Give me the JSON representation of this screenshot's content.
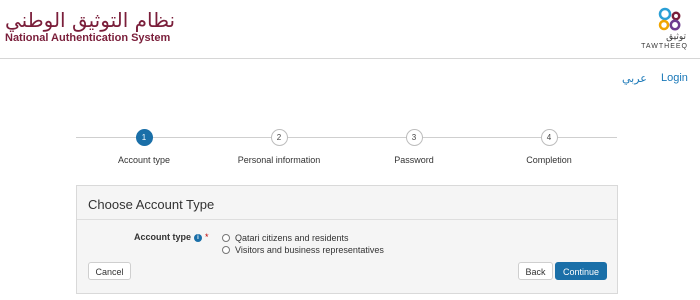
{
  "header": {
    "title_ar": "نظام التوثيق الوطني",
    "title_en": "National Authentication System",
    "logo_text_ar": "توثيق",
    "logo_text_en": "TAWTHEEQ"
  },
  "nav": {
    "language_label": "عربي",
    "login_label": "Login"
  },
  "stepper": {
    "steps": [
      {
        "number": "1",
        "label": "Account type",
        "active": true
      },
      {
        "number": "2",
        "label": "Personal information",
        "active": false
      },
      {
        "number": "3",
        "label": "Password",
        "active": false
      },
      {
        "number": "4",
        "label": "Completion",
        "active": false
      }
    ]
  },
  "form": {
    "title": "Choose Account Type",
    "field_label": "Account type",
    "required_marker": "*",
    "info_icon": "i",
    "options": [
      {
        "label": "Qatari citizens and residents",
        "selected": false
      },
      {
        "label": "Visitors and business representatives",
        "selected": false
      }
    ],
    "cancel_label": "Cancel",
    "back_label": "Back",
    "continue_label": "Continue"
  },
  "colors": {
    "brand": "#7a1e3a",
    "accent": "#1a6fa8"
  }
}
